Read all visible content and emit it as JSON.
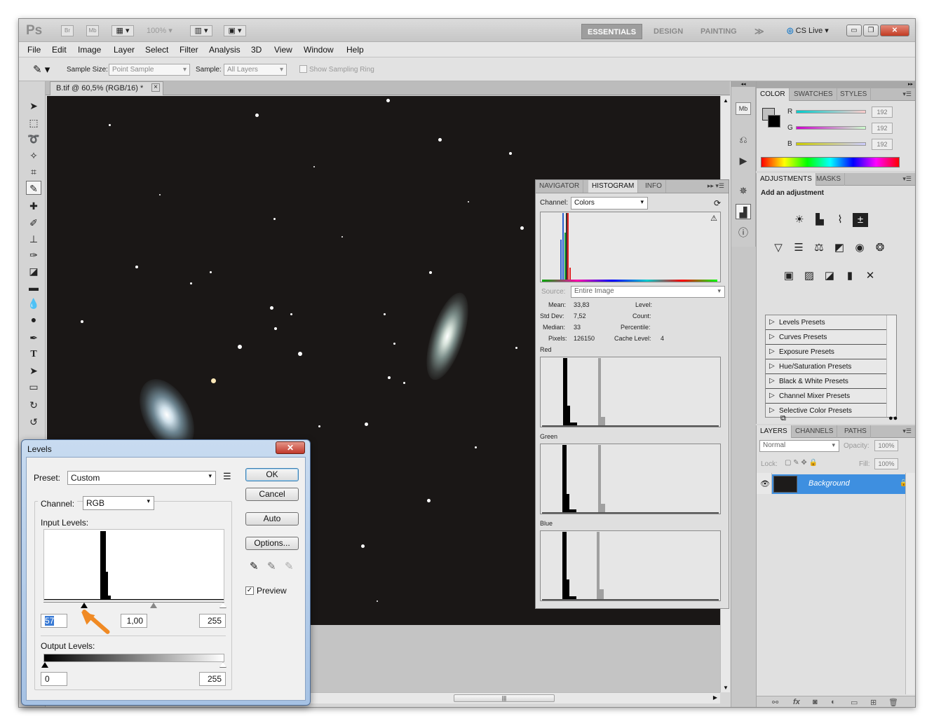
{
  "app": {
    "logo": "Ps",
    "bridge": "Br",
    "minibridge": "Mb",
    "zoom": "100%",
    "workspaces": [
      "ESSENTIALS",
      "DESIGN",
      "PAINTING"
    ],
    "more": "≫",
    "cslive": "CS Live"
  },
  "menu": [
    "File",
    "Edit",
    "Image",
    "Layer",
    "Select",
    "Filter",
    "Analysis",
    "3D",
    "View",
    "Window",
    "Help"
  ],
  "options": {
    "sample_size_label": "Sample Size:",
    "sample_size_value": "Point Sample",
    "sample_label": "Sample:",
    "sample_value": "All Layers",
    "ring_label": "Show Sampling Ring"
  },
  "document": {
    "tab_title": "B.tif @ 60,5% (RGB/16) *",
    "close": "×"
  },
  "color_panel": {
    "tabs": [
      "COLOR",
      "SWATCHES",
      "STYLES"
    ],
    "channels": [
      {
        "label": "R",
        "value": "192"
      },
      {
        "label": "G",
        "value": "192"
      },
      {
        "label": "B",
        "value": "192"
      }
    ]
  },
  "adjustments_panel": {
    "tabs": [
      "ADJUSTMENTS",
      "MASKS"
    ],
    "heading": "Add an adjustment",
    "presets": [
      "Levels Presets",
      "Curves Presets",
      "Exposure Presets",
      "Hue/Saturation Presets",
      "Black & White Presets",
      "Channel Mixer Presets",
      "Selective Color Presets"
    ]
  },
  "layers_panel": {
    "tabs": [
      "LAYERS",
      "CHANNELS",
      "PATHS"
    ],
    "blend_mode": "Normal",
    "opacity_label": "Opacity:",
    "opacity_value": "100%",
    "lock_label": "Lock:",
    "fill_label": "Fill:",
    "fill_value": "100%",
    "layer_name": "Background"
  },
  "histogram_panel": {
    "tabs": [
      "NAVIGATOR",
      "HISTOGRAM",
      "INFO"
    ],
    "channel_label": "Channel:",
    "channel_value": "Colors",
    "source_label": "Source:",
    "source_value": "Entire Image",
    "stats": {
      "mean_label": "Mean:",
      "mean": "33,83",
      "std_label": "Std Dev:",
      "std": "7,52",
      "median_label": "Median:",
      "median": "33",
      "pixels_label": "Pixels:",
      "pixels": "126150",
      "level_label": "Level:",
      "count_label": "Count:",
      "percentile_label": "Percentile:",
      "cache_label": "Cache Level:",
      "cache": "4"
    },
    "channels": [
      "Red",
      "Green",
      "Blue"
    ]
  },
  "levels_dialog": {
    "title": "Levels",
    "close": "✕",
    "preset_label": "Preset:",
    "preset_value": "Custom",
    "channel_label": "Channel:",
    "channel_value": "RGB",
    "input_label": "Input Levels:",
    "input_black": "57",
    "input_gamma": "1,00",
    "input_white": "255",
    "output_label": "Output Levels:",
    "output_black": "0",
    "output_white": "255",
    "buttons": {
      "ok": "OK",
      "cancel": "Cancel",
      "auto": "Auto",
      "options": "Options..."
    },
    "preview_label": "Preview"
  },
  "colors": {
    "accent": "#3e8fe0",
    "arrow": "#f08a24",
    "canvas": "#1a1716"
  }
}
